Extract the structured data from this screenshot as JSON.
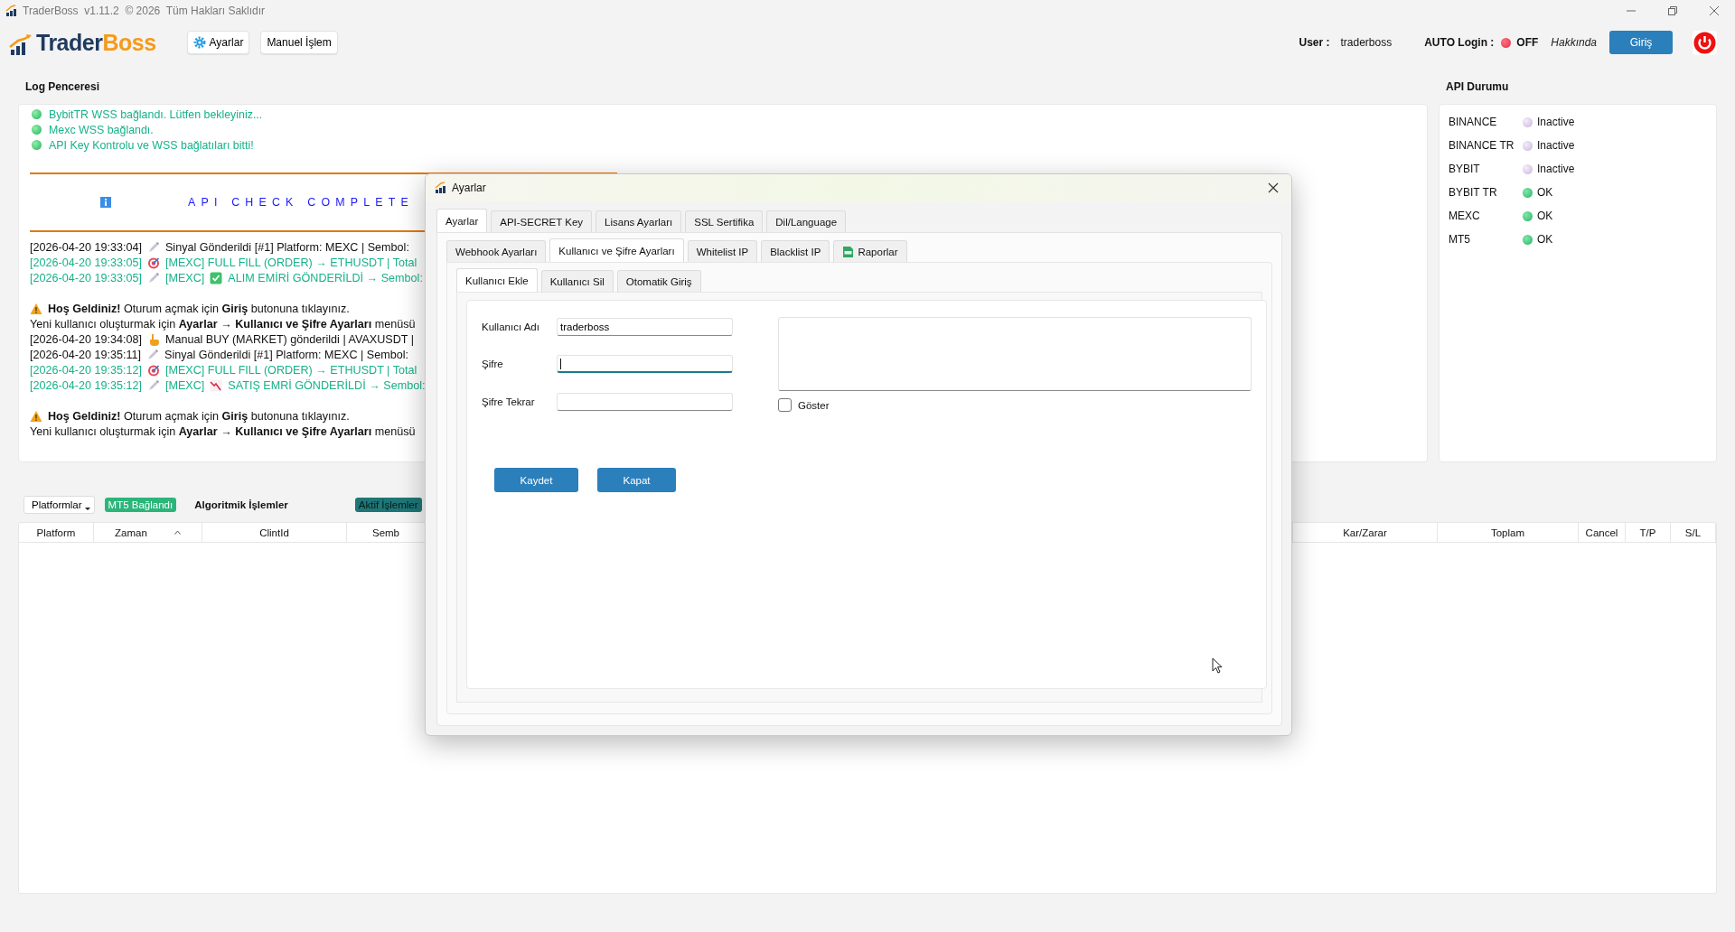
{
  "window": {
    "title": "TraderBoss  v1.11.2  © 2026  Tüm Hakları Saklıdır"
  },
  "toolbar": {
    "logo": {
      "first": "Trader",
      "second": "Boss"
    },
    "buttons": [
      {
        "label": "Ayarlar",
        "kind": "settings"
      },
      {
        "label": "Manuel İşlem",
        "kind": "plain"
      }
    ],
    "user_label": "User :",
    "user": "traderboss",
    "auto_login": {
      "label": "AUTO Login :",
      "on": false,
      "state": "OFF"
    },
    "about_link": "Hakkında",
    "login_button": "Giriş"
  },
  "log": {
    "title": "Log Penceresi",
    "entries": [
      {
        "kind": "status",
        "text": "BybitTR WSS bağlandı. Lütfen bekleyiniz..."
      },
      {
        "kind": "status",
        "text": "Mexc WSS bağlandı."
      },
      {
        "kind": "status",
        "text": "API Key Kontrolu ve WSS bağlatıları bitti!"
      },
      {
        "kind": "rule"
      },
      {
        "kind": "banner",
        "text": "API CHECK COMPLETE"
      },
      {
        "kind": "rule"
      },
      {
        "kind": "line",
        "color": "#111111",
        "parts": [
          {
            "kind": "text",
            "text": "[2026-04-20 19:33:04]"
          },
          {
            "kind": "pen"
          },
          {
            "kind": "text",
            "text": "Sinyal Gönderildi [#1] Platform: MEXC | Sembol:"
          }
        ]
      },
      {
        "kind": "line",
        "color": "#17b28a",
        "parts": [
          {
            "kind": "text",
            "text": "[2026-04-20 19:33:05]"
          },
          {
            "kind": "target"
          },
          {
            "kind": "text",
            "text": "[MEXC] FULL FILL (ORDER) → ETHUSDT | Total"
          }
        ]
      },
      {
        "kind": "line",
        "color": "#17b28a",
        "parts": [
          {
            "kind": "text",
            "text": "[2026-04-20 19:33:05]"
          },
          {
            "kind": "pen"
          },
          {
            "kind": "text",
            "text": "[MEXC]"
          },
          {
            "kind": "check"
          },
          {
            "kind": "text",
            "text": "ALIM EMİRİ GÖNDERİLDİ → Sembol:"
          }
        ]
      },
      {
        "kind": "blank"
      },
      {
        "kind": "line",
        "color": "#111111",
        "parts": [
          {
            "kind": "warning"
          },
          {
            "kind": "text",
            "text": "**Hoş Geldiniz!** Oturum açmak için **Giriş** butonuna tıklayınız."
          }
        ]
      },
      {
        "kind": "line",
        "color": "#111111",
        "parts": [
          {
            "kind": "text",
            "text": "Yeni kullanıcı oluşturmak için **Ayarlar → Kullanıcı ve Şifre Ayarları** menüsü"
          }
        ]
      },
      {
        "kind": "line",
        "color": "#111111",
        "parts": [
          {
            "kind": "text",
            "text": "[2026-04-20 19:34:08]"
          },
          {
            "kind": "hand"
          },
          {
            "kind": "text",
            "text": "Manual BUY (MARKET) gönderildi | AVAXUSDT |"
          }
        ]
      },
      {
        "kind": "line",
        "color": "#111111",
        "parts": [
          {
            "kind": "text",
            "text": "[2026-04-20 19:35:11]"
          },
          {
            "kind": "pen"
          },
          {
            "kind": "text",
            "text": "Sinyal Gönderildi [#1] Platform: MEXC | Sembol:"
          }
        ]
      },
      {
        "kind": "line",
        "color": "#17b28a",
        "parts": [
          {
            "kind": "text",
            "text": "[2026-04-20 19:35:12]"
          },
          {
            "kind": "target"
          },
          {
            "kind": "text",
            "text": "[MEXC] FULL FILL (ORDER) → ETHUSDT | Total"
          }
        ]
      },
      {
        "kind": "line",
        "color": "#17b28a",
        "parts": [
          {
            "kind": "text",
            "text": "[2026-04-20 19:35:12]"
          },
          {
            "kind": "pen"
          },
          {
            "kind": "text",
            "text": "[MEXC]"
          },
          {
            "kind": "chart"
          },
          {
            "kind": "text",
            "text": "SATIŞ EMRİ GÖNDERİLDİ → Sembol:"
          }
        ]
      },
      {
        "kind": "blank"
      },
      {
        "kind": "line",
        "color": "#111111",
        "parts": [
          {
            "kind": "warning"
          },
          {
            "kind": "text",
            "text": "**Hoş Geldiniz!** Oturum açmak için **Giriş** butonuna tıklayınız."
          }
        ]
      },
      {
        "kind": "line",
        "color": "#111111",
        "parts": [
          {
            "kind": "text",
            "text": "Yeni kullanıcı oluşturmak için **Ayarlar → Kullanıcı ve Şifre Ayarları** menüsü"
          }
        ]
      }
    ]
  },
  "api": {
    "title": "API Durumu",
    "items": [
      {
        "name": "BINANCE",
        "active": false,
        "status": "Inactive"
      },
      {
        "name": "BINANCE TR",
        "active": false,
        "status": "Inactive"
      },
      {
        "name": "BYBIT",
        "active": false,
        "status": "Inactive"
      },
      {
        "name": "BYBIT TR",
        "active": true,
        "status": "OK"
      },
      {
        "name": "MEXC",
        "active": true,
        "status": "OK"
      },
      {
        "name": "MT5",
        "active": true,
        "status": "OK"
      }
    ]
  },
  "trades": {
    "platform_dropdown": "Platformlar",
    "mt5_badge": "MT5 Bağlandı",
    "algo_label": "Algoritmik İşlemler",
    "active_badge": "Aktif İşlemler",
    "columns": [
      {
        "label": "Platform",
        "sorted": false
      },
      {
        "label": "Zaman",
        "sorted": true
      },
      {
        "label": "ClintId",
        "sorted": false
      },
      {
        "label": "Semb",
        "sorted": false
      },
      {
        "label": "Kar/Zarar",
        "sorted": false
      },
      {
        "label": "Toplam",
        "sorted": false
      },
      {
        "label": "Cancel",
        "sorted": false
      },
      {
        "label": "T/P",
        "sorted": false
      },
      {
        "label": "S/L",
        "sorted": false
      }
    ]
  },
  "dialog": {
    "title": "Ayarlar",
    "tabs": [
      {
        "label": "Ayarlar",
        "selected": true
      },
      {
        "label": "API-SECRET Key",
        "selected": false
      },
      {
        "label": "Lisans Ayarları",
        "selected": false
      },
      {
        "label": "SSL Sertifika",
        "selected": false
      },
      {
        "label": "Dil/Language",
        "selected": false
      }
    ],
    "subtabs": [
      {
        "label": "Webhook Ayarları",
        "selected": false,
        "kind": "plain"
      },
      {
        "label": "Kullanıcı ve Şifre Ayarları",
        "selected": true,
        "kind": "plain"
      },
      {
        "label": "Whitelist IP",
        "selected": false,
        "kind": "plain"
      },
      {
        "label": "Blacklist IP",
        "selected": false,
        "kind": "plain"
      },
      {
        "label": "Raporlar",
        "selected": false,
        "kind": "report"
      }
    ],
    "user_tabs": [
      {
        "label": "Kullanıcı Ekle",
        "selected": true
      },
      {
        "label": "Kullanıcı Sil",
        "selected": false
      },
      {
        "label": "Otomatik Giriş",
        "selected": false
      }
    ],
    "fields": [
      {
        "label": "Kullanıcı Adı",
        "value": "traderboss",
        "focused": false
      },
      {
        "label": "Şifre",
        "focused": true
      },
      {
        "label": "Şifre Tekrar",
        "focused": false
      }
    ],
    "show_password": {
      "label": "Göster",
      "checked": false
    },
    "buttons": [
      "Kaydet",
      "Kapat"
    ]
  }
}
